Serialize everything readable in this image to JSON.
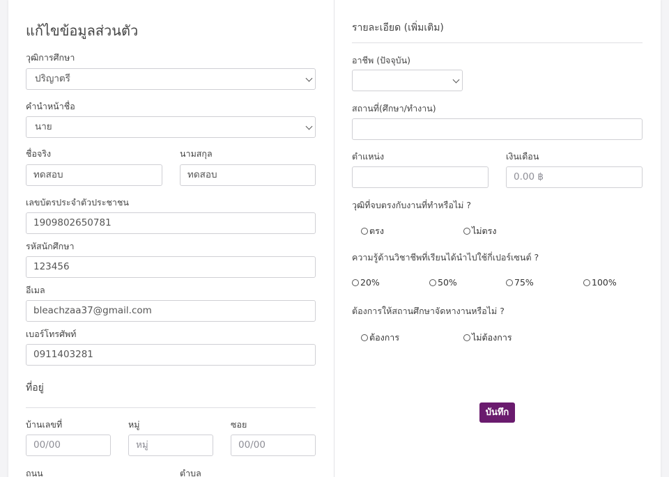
{
  "left": {
    "title": "แก้ไขข้อมูลส่วนตัว",
    "education": {
      "label": "วุฒิการศึกษา",
      "value": "ปริญาตรี"
    },
    "prefix": {
      "label": "คำนำหน้าชื่อ",
      "value": "นาย"
    },
    "first_name": {
      "label": "ชื่อจริง",
      "value": "ทดสอบ"
    },
    "last_name": {
      "label": "นามสกุล",
      "value": "ทดสอบ"
    },
    "id_card": {
      "label": "เลขบัตรประจำตัวประชาชน",
      "value": "1909802650781"
    },
    "student_id": {
      "label": "รหัสนักศึกษา",
      "value": "123456"
    },
    "email": {
      "label": "อีเมล",
      "value": "bleachzaa37@gmail.com"
    },
    "phone": {
      "label": "เบอร์โทรศัพท์",
      "value": "0911403281"
    },
    "address": {
      "heading": "ที่อยู่",
      "house_no": {
        "label": "บ้านเลขที่",
        "placeholder": "00/00"
      },
      "moo": {
        "label": "หมู่",
        "placeholder": "หมู่"
      },
      "soi": {
        "label": "ซอย",
        "placeholder": "00/00"
      },
      "road": {
        "label": "ถนน"
      },
      "subdistrict": {
        "label": "ตำบล"
      }
    }
  },
  "right": {
    "title": "รายละเอียด (เพิ่มเติม)",
    "occupation": {
      "label": "อาชีพ (ปัจจุบัน)",
      "value": ""
    },
    "workplace": {
      "label": "สถานที่(ศึกษา/ทำงาน)",
      "value": ""
    },
    "position": {
      "label": "ตำแหน่ง",
      "value": ""
    },
    "salary": {
      "label": "เงินเดือน",
      "placeholder": "0.00 ฿"
    },
    "q_match": {
      "question": "วุฒิที่จบตรงกับงานที่ทำหรือไม่ ?",
      "options": [
        "ตรง",
        "ไม่ตรง"
      ]
    },
    "q_knowledge": {
      "question": "ความรู้ด้านวิชาชีพที่เรียนได้นำไปใช้กี่เปอร์เซนต์ ?",
      "options": [
        "20%",
        "50%",
        "75%",
        "100%"
      ]
    },
    "q_job": {
      "question": "ต้องการให้สถานศึกษาจัดหางานหรือไม่ ?",
      "options": [
        "ต้องการ",
        "ไม่ต้องการ"
      ]
    },
    "save_label": "บันทึก",
    "accent_color": "#6a1b6e"
  }
}
